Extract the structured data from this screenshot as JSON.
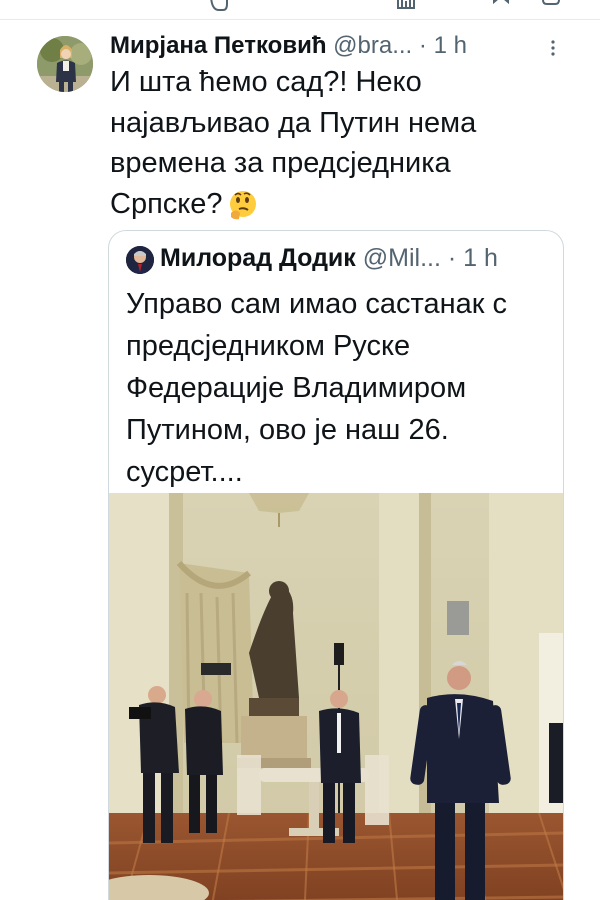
{
  "tweet": {
    "author_name": "Мирјана Петковић",
    "handle": "@bra...",
    "separator": "·",
    "time": "1 h",
    "text": "И шта ћемо сад?! Неко најављивао да Путин нема времена за предсједника Српске?",
    "emoji": "thinking-face"
  },
  "quoted_tweet": {
    "author_name": "Милорад Додик",
    "handle": "@Mil...",
    "separator": "·",
    "time": "1 h",
    "text": "Управо сам имао састанак с предсједником Руске Федерације Владимиром Путином, ово је наш 26. сусрет...."
  },
  "icons": [
    "reply-icon",
    "share-icon",
    "bookmark-icon",
    "more-options-icon"
  ]
}
